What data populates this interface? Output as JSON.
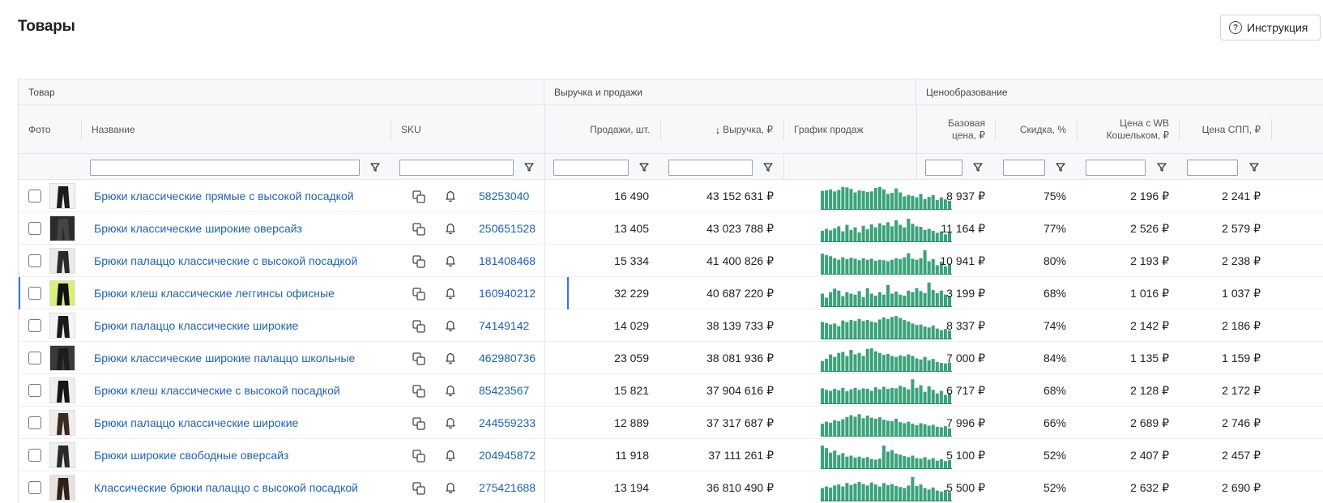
{
  "page": {
    "title": "Товары",
    "instruction_label": "Инструкция"
  },
  "colors": {
    "link": "#1f62b5",
    "bar": "#3aa37a",
    "selected": "#2f7be0"
  },
  "groups": {
    "product": "Товар",
    "revenue": "Выручка и продажи",
    "pricing": "Ценообразование"
  },
  "columns": {
    "photo": "Фото",
    "name": "Название",
    "sku": "SKU",
    "sales": "Продажи, шт.",
    "revenue": "Выручка, ₽",
    "revenue_sort_icon": "↓",
    "chart": "График продаж",
    "base_price_l1": "Базовая",
    "base_price_l2": "цена, ₽",
    "discount": "Скидка, %",
    "wb_price_l1": "Цена с WB",
    "wb_price_l2": "Кошельком, ₽",
    "spp_price": "Цена СПП, ₽"
  },
  "rows": [
    {
      "name": "Брюки классические прямые с высокой посадкой",
      "sku": "58253040",
      "sales": "16 490",
      "revenue": "43 152 631 ₽",
      "base_price": "8 937 ₽",
      "discount": "75%",
      "wb_price": "2 196 ₽",
      "spp_price": "2 241 ₽",
      "selected": false,
      "spark": [
        0.72,
        0.74,
        0.78,
        0.7,
        0.76,
        0.88,
        0.86,
        0.8,
        0.66,
        0.74,
        0.72,
        0.68,
        0.7,
        0.84,
        0.88,
        0.78,
        0.6,
        0.64,
        0.82,
        0.66,
        0.5,
        0.56,
        0.52,
        0.46,
        0.6,
        0.4,
        0.48,
        0.55,
        0.36,
        0.46,
        0.38,
        0.32
      ]
    },
    {
      "name": "Брюки классические широкие оверсайз",
      "sku": "250651528",
      "sales": "13 405",
      "revenue": "43 023 788 ₽",
      "base_price": "11 164 ₽",
      "discount": "77%",
      "wb_price": "2 526 ₽",
      "spp_price": "2 579 ₽",
      "selected": false,
      "spark": [
        0.42,
        0.5,
        0.44,
        0.52,
        0.6,
        0.4,
        0.66,
        0.46,
        0.56,
        0.36,
        0.62,
        0.48,
        0.68,
        0.56,
        0.72,
        0.64,
        0.76,
        0.6,
        0.84,
        0.66,
        0.56,
        0.9,
        0.7,
        0.6,
        0.58,
        0.46,
        0.5,
        0.42,
        0.34,
        0.4,
        0.28,
        0.36
      ]
    },
    {
      "name": "Брюки палаццо классические с высокой посадкой",
      "sku": "181408468",
      "sales": "15 334",
      "revenue": "41 400 826 ₽",
      "base_price": "10 941 ₽",
      "discount": "80%",
      "wb_price": "2 193 ₽",
      "spp_price": "2 238 ₽",
      "selected": false,
      "spark": [
        0.8,
        0.74,
        0.7,
        0.62,
        0.56,
        0.66,
        0.58,
        0.64,
        0.6,
        0.54,
        0.62,
        0.56,
        0.6,
        0.52,
        0.56,
        0.54,
        0.5,
        0.56,
        0.62,
        0.58,
        0.66,
        0.82,
        0.6,
        0.56,
        0.62,
        0.94,
        0.5,
        0.58,
        0.34,
        0.48,
        0.3,
        0.4
      ]
    },
    {
      "name": "Брюки клеш классические леггинсы офисные",
      "sku": "160940212",
      "sales": "32 229",
      "revenue": "40 687 220 ₽",
      "base_price": "3 199 ₽",
      "discount": "68%",
      "wb_price": "1 016 ₽",
      "spp_price": "1 037 ₽",
      "selected": true,
      "spark": [
        0.5,
        0.34,
        0.56,
        0.7,
        0.62,
        0.4,
        0.56,
        0.5,
        0.46,
        0.6,
        0.36,
        0.72,
        0.5,
        0.42,
        0.56,
        0.46,
        0.84,
        0.5,
        0.58,
        0.46,
        0.42,
        0.62,
        0.56,
        0.72,
        0.6,
        0.52,
        0.94,
        0.64,
        0.52,
        0.62,
        0.46,
        0.4
      ]
    },
    {
      "name": "Брюки палаццо классические широкие",
      "sku": "74149142",
      "sales": "14 029",
      "revenue": "38 139 733 ₽",
      "base_price": "8 337 ₽",
      "discount": "74%",
      "wb_price": "2 142 ₽",
      "spp_price": "2 186 ₽",
      "selected": false,
      "spark": [
        0.66,
        0.62,
        0.56,
        0.6,
        0.5,
        0.72,
        0.66,
        0.74,
        0.7,
        0.78,
        0.7,
        0.74,
        0.68,
        0.64,
        0.76,
        0.84,
        0.78,
        0.86,
        0.9,
        0.82,
        0.74,
        0.68,
        0.6,
        0.54,
        0.56,
        0.48,
        0.44,
        0.52,
        0.4,
        0.34,
        0.38,
        0.32
      ]
    },
    {
      "name": "Брюки классические широкие палаццо школьные",
      "sku": "462980736",
      "sales": "23 059",
      "revenue": "38 081 936 ₽",
      "base_price": "7 000 ₽",
      "discount": "84%",
      "wb_price": "1 135 ₽",
      "spp_price": "1 159 ₽",
      "selected": false,
      "spark": [
        0.4,
        0.48,
        0.66,
        0.56,
        0.72,
        0.76,
        0.6,
        0.84,
        0.66,
        0.72,
        0.6,
        0.88,
        0.9,
        0.78,
        0.72,
        0.64,
        0.68,
        0.6,
        0.56,
        0.62,
        0.58,
        0.66,
        0.6,
        0.5,
        0.46,
        0.56,
        0.42,
        0.48,
        0.36,
        0.32,
        0.3,
        0.34
      ]
    },
    {
      "name": "Брюки клеш классические с высокой посадкой",
      "sku": "85423567",
      "sales": "15 821",
      "revenue": "37 904 616 ₽",
      "base_price": "6 717 ₽",
      "discount": "68%",
      "wb_price": "2 128 ₽",
      "spp_price": "2 172 ₽",
      "selected": false,
      "spark": [
        0.6,
        0.54,
        0.5,
        0.58,
        0.52,
        0.62,
        0.48,
        0.56,
        0.62,
        0.54,
        0.6,
        0.58,
        0.5,
        0.64,
        0.56,
        0.66,
        0.58,
        0.62,
        0.6,
        0.7,
        0.64,
        0.56,
        0.96,
        0.62,
        0.72,
        0.46,
        0.68,
        0.54,
        0.4,
        0.5,
        0.34,
        0.42
      ]
    },
    {
      "name": "Брюки палаццо классические широкие",
      "sku": "244559233",
      "sales": "12 889",
      "revenue": "37 317 687 ₽",
      "base_price": "7 996 ₽",
      "discount": "66%",
      "wb_price": "2 689 ₽",
      "spp_price": "2 746 ₽",
      "selected": false,
      "spark": [
        0.48,
        0.56,
        0.52,
        0.62,
        0.58,
        0.66,
        0.74,
        0.82,
        0.76,
        0.86,
        0.7,
        0.8,
        0.72,
        0.68,
        0.74,
        0.64,
        0.6,
        0.58,
        0.68,
        0.54,
        0.5,
        0.56,
        0.48,
        0.42,
        0.5,
        0.46,
        0.4,
        0.44,
        0.36,
        0.34,
        0.38,
        0.3
      ]
    },
    {
      "name": "Брюки широкие свободные оверсайз",
      "sku": "204945872",
      "sales": "11 918",
      "revenue": "37 111 261 ₽",
      "base_price": "5 100 ₽",
      "discount": "52%",
      "wb_price": "2 407 ₽",
      "spp_price": "2 457 ₽",
      "selected": false,
      "spark": [
        0.9,
        0.8,
        0.62,
        0.7,
        0.52,
        0.6,
        0.46,
        0.5,
        0.42,
        0.46,
        0.4,
        0.44,
        0.36,
        0.34,
        0.38,
        0.9,
        0.66,
        0.72,
        0.58,
        0.54,
        0.48,
        0.44,
        0.5,
        0.4,
        0.38,
        0.44,
        0.34,
        0.4,
        0.3,
        0.36,
        0.28,
        0.32
      ]
    },
    {
      "name": "Классические брюки палаццо с высокой посадкой",
      "sku": "275421688",
      "sales": "13 194",
      "revenue": "36 810 490 ₽",
      "base_price": "5 500 ₽",
      "discount": "52%",
      "wb_price": "2 632 ₽",
      "spp_price": "2 690 ₽",
      "selected": false,
      "spark": [
        0.5,
        0.56,
        0.52,
        0.6,
        0.64,
        0.56,
        0.7,
        0.62,
        0.68,
        0.74,
        0.66,
        0.6,
        0.72,
        0.64,
        0.56,
        0.7,
        0.62,
        0.66,
        0.58,
        0.54,
        0.5,
        0.6,
        0.94,
        0.58,
        0.64,
        0.5,
        0.44,
        0.52,
        0.4,
        0.36,
        0.42,
        0.34
      ]
    }
  ]
}
